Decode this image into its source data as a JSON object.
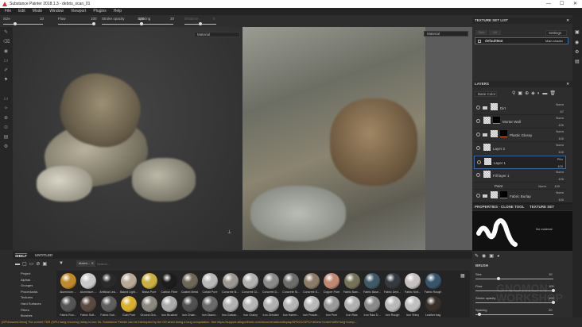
{
  "window": {
    "title": "Substance Painter 2018.1.3 - debris_scan_01",
    "controls": [
      "—",
      "☐",
      "✕"
    ]
  },
  "menu": [
    "File",
    "Edit",
    "Mode",
    "Window",
    "Viewport",
    "Plugins",
    "Help"
  ],
  "tool_options": {
    "sliders": [
      {
        "label": "Size",
        "value": "10",
        "fraction": 0.3
      },
      {
        "label": "Flow",
        "value": "100",
        "fraction": 1.0
      },
      {
        "label": "Stroke opacity",
        "value": "100",
        "fraction": 1.0
      },
      {
        "label": "Spacing",
        "value": "20",
        "fraction": 0.1
      },
      {
        "label": "Distance",
        "value": "5",
        "fraction": 0.5
      }
    ]
  },
  "viewport": {
    "left_mode": "Material",
    "right_mode": "Material"
  },
  "texture_set_list": {
    "title": "TEXTURE SET LIST",
    "buttons": [
      "Solo",
      "All"
    ],
    "settings": "Settings",
    "item": "defaultMat",
    "shader": "Main shader"
  },
  "layers": {
    "title": "LAYERS",
    "channel": "Base Color",
    "items": [
      {
        "name": "Dirt",
        "blend": "Norm",
        "opacity": "67",
        "folder": true,
        "mask": false
      },
      {
        "name": "Mortar Wall",
        "blend": "Norm",
        "opacity": "100",
        "folder": false,
        "mask": true
      },
      {
        "name": "Plastic Glossy",
        "blend": "Norm",
        "opacity": "100",
        "folder": true,
        "mask": true
      },
      {
        "name": "Layer 2",
        "blend": "Norm",
        "opacity": "100",
        "folder": false,
        "mask": false
      },
      {
        "name": "Layer 1",
        "blend": "Pthr",
        "opacity": "100",
        "folder": false,
        "mask": false,
        "selected": true
      },
      {
        "name": "Fill layer 1",
        "blend": "Norm",
        "opacity": "100",
        "folder": false,
        "mask": false
      },
      {
        "name": "Fabric Burlap",
        "blend": "Norm",
        "opacity": "100",
        "folder": true,
        "mask": true
      }
    ],
    "effect": {
      "name": "Paint",
      "blend": "Norm",
      "opacity": "100"
    }
  },
  "properties": {
    "title": "PROPERTIES - CLONE TOOL",
    "other_tab": "TEXTURE SET SETTINGS",
    "no_material": "No material",
    "section": "BRUSH",
    "sliders": [
      {
        "label": "Size",
        "value": "10",
        "fraction": 0.3
      },
      {
        "label": "Flow",
        "value": "100",
        "fraction": 1.0
      },
      {
        "label": "Stroke opacity",
        "value": "100",
        "fraction": 1.0
      },
      {
        "label": "Spacing",
        "value": "20",
        "fraction": 0.05
      }
    ]
  },
  "watermark": {
    "line1": "GNOMON",
    "line2": "WORKSHOP"
  },
  "shelf": {
    "tabs": [
      "SHELF",
      "UNTITLED"
    ],
    "filter_chip": "Materi...",
    "search_placeholder": "Search...",
    "categories": [
      "Project",
      "Alphas",
      "Grunges",
      "Procedurals",
      "Textures",
      "Hard Surfaces",
      "Filters",
      "Brushes"
    ],
    "materials_row1": [
      {
        "name": "Aluminium ...",
        "color": "#c08a2a"
      },
      {
        "name": "Aluminium ...",
        "color": "#c8c8c8"
      },
      {
        "name": "Artificial Lea...",
        "color": "#2a2a2a"
      },
      {
        "name": "Baked Light...",
        "color": "#b8a898"
      },
      {
        "name": "Brass Pure",
        "color": "#c9b040"
      },
      {
        "name": "Carbon Fiber",
        "color": "#1c1c1c"
      },
      {
        "name": "Coated Metal",
        "color": "#6e6656"
      },
      {
        "name": "Cobalt Pure",
        "color": "#b8b8b8"
      },
      {
        "name": "Concrete B...",
        "color": "#9c978e"
      },
      {
        "name": "Concrete Cl...",
        "color": "#b0b0ae"
      },
      {
        "name": "Concrete D...",
        "color": "#8a8a88"
      },
      {
        "name": "Concrete Si...",
        "color": "#6c6c6a"
      },
      {
        "name": "Concrete S...",
        "color": "#8a7c68"
      },
      {
        "name": "Copper Pure",
        "color": "#c08870"
      },
      {
        "name": "Fabric Barn...",
        "color": "#767258"
      },
      {
        "name": "Fabric Base...",
        "color": "#3e5a66"
      },
      {
        "name": "Fabric Deni...",
        "color": "#343a40"
      },
      {
        "name": "Fabric Knit...",
        "color": "#c6c0c0"
      },
      {
        "name": "Fabric Rough",
        "color": "#36546a"
      }
    ],
    "materials_row2": [
      {
        "name": "Fabric Rou...",
        "color": "#555"
      },
      {
        "name": "Fabric Soft...",
        "color": "#5a4a40"
      },
      {
        "name": "Fabric Suit...",
        "color": "#5e5e5e"
      },
      {
        "name": "Gold Pure",
        "color": "#d8b030"
      },
      {
        "name": "Ground Gra...",
        "color": "#8c8880"
      },
      {
        "name": "Iron Brushed",
        "color": "#aaa"
      },
      {
        "name": "Iron Chain...",
        "color": "#505050"
      },
      {
        "name": "Iron Diamo...",
        "color": "#6a6a6a"
      },
      {
        "name": "Iron Galvan...",
        "color": "#b0b0b0"
      },
      {
        "name": "Iron Grainy",
        "color": "#b4b4b4"
      },
      {
        "name": "Iron Grinded",
        "color": "#b0b0b0"
      },
      {
        "name": "Iron Hamm...",
        "color": "#b4b4b4"
      },
      {
        "name": "Iron Powde...",
        "color": "#b8b8b8"
      },
      {
        "name": "Iron Pure",
        "color": "#9a9a9a"
      },
      {
        "name": "Iron Raw",
        "color": "#b0b0b0"
      },
      {
        "name": "Iron Raw D...",
        "color": "#8a8a8a"
      },
      {
        "name": "Iron Rough",
        "color": "#b8b8b8"
      },
      {
        "name": "Iron Shiny",
        "color": "#c0c0c0"
      },
      {
        "name": "Leather bag",
        "color": "#3a302a"
      }
    ]
  },
  "status": "[GPUIssuesCheck] The current TDR (GPU hang recovery) delay is low: 5s. Substance Painter can be interrupted by the OS when doing a long computation. See https://support.allegorithmic.com/documentation/display/SPDOC/GPU+drivers+crash+with+long+comp..."
}
